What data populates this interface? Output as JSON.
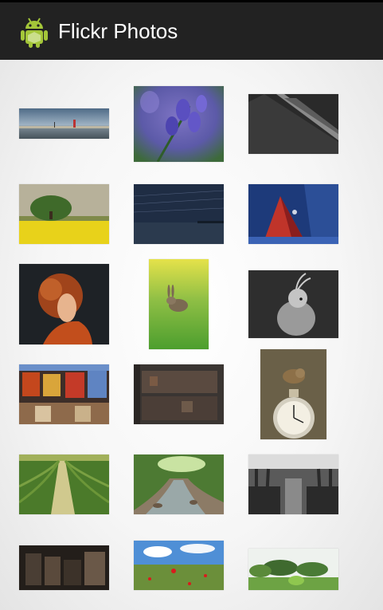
{
  "app": {
    "title": "Flickr Photos",
    "icon": "android-robot-icon",
    "accent_color": "#a4c639"
  },
  "photos": [
    {
      "name": "photo-harbor-sunset"
    },
    {
      "name": "photo-bluebells"
    },
    {
      "name": "photo-dark-rail-track"
    },
    {
      "name": "photo-rapeseed-field-tree"
    },
    {
      "name": "photo-star-trails-sea"
    },
    {
      "name": "photo-tent-night-forest"
    },
    {
      "name": "photo-redhead-portrait"
    },
    {
      "name": "photo-rabbit-grass"
    },
    {
      "name": "photo-cockatiel-bw"
    },
    {
      "name": "photo-arcade-machines"
    },
    {
      "name": "photo-rusty-panels"
    },
    {
      "name": "photo-bird-on-clock"
    },
    {
      "name": "photo-tea-field-rows"
    },
    {
      "name": "photo-forest-stream"
    },
    {
      "name": "photo-train-interior-bw"
    },
    {
      "name": "photo-dark-warehouse"
    },
    {
      "name": "photo-poppy-field-sky"
    },
    {
      "name": "photo-garden-hedges"
    }
  ]
}
